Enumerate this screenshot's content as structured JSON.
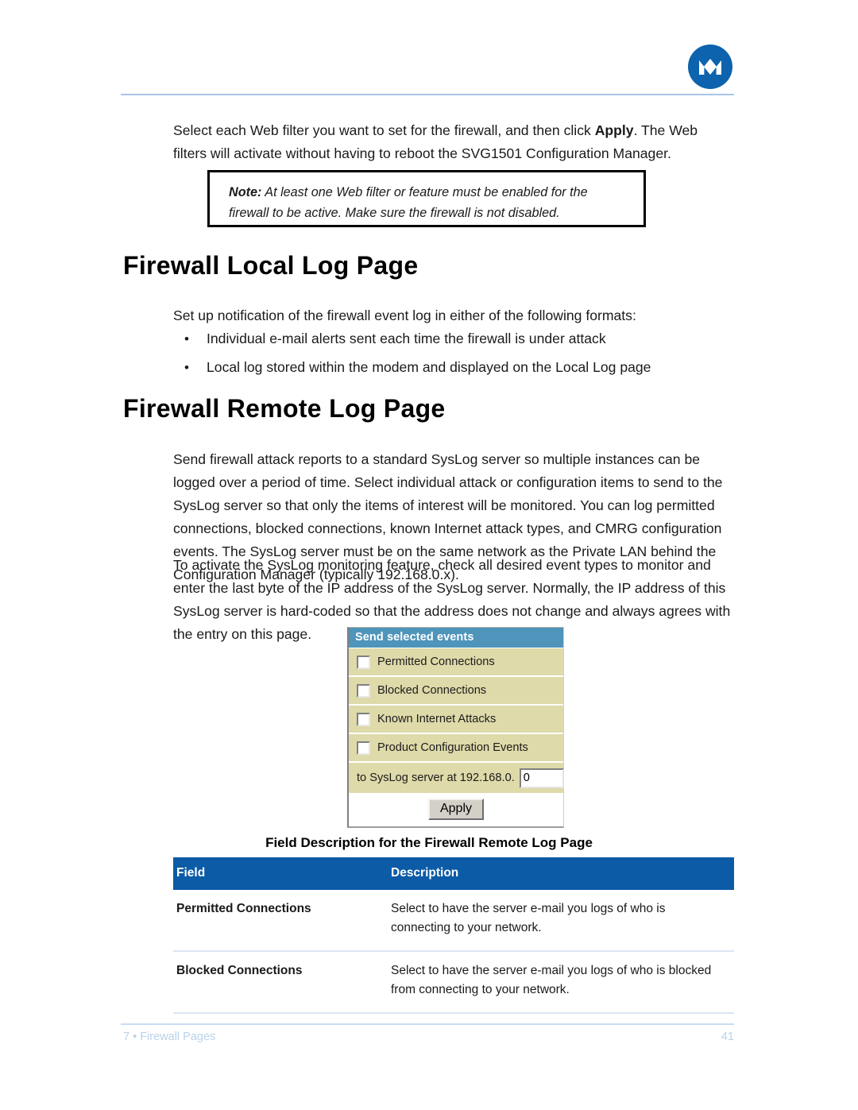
{
  "header": {
    "logo_name": "motorola-logo",
    "logo_color": "#0d63ad"
  },
  "intro": {
    "text_before_bold": "Select  each Web filter you want to set for the firewall, and then click ",
    "bold_word": "Apply",
    "text_after_bold": ". The Web filters will activate without having to reboot the SVG1501 Configuration Manager."
  },
  "note": {
    "label": "Note:",
    "text": " At least one Web filter or feature must be enabled for the firewall to be active. Make sure the firewall is not disabled."
  },
  "sections": {
    "local_heading": "Firewall Local Log Page",
    "local_intro": "Set up notification of the firewall event log in either of the following formats:",
    "local_bullets": [
      "Individual e-mail alerts sent each time the firewall is under attack",
      "Local log stored within the modem and displayed on the Local Log page"
    ],
    "remote_heading": "Firewall Remote Log Page",
    "remote_para_1": "Send firewall attack reports to a standard SysLog server so multiple instances can be logged over a period of time. Select individual attack or configuration items to send to the SysLog server so that only the items of interest will be monitored. You can log permitted connections, blocked connections, known Internet attack types, and CMRG configuration events. The SysLog server must be on the same network as the Private LAN behind the Configuration Manager (typically 192.168.0.x).",
    "remote_para_2": "To activate the SysLog monitoring feature, check all desired event types to monitor and enter the last byte of the IP address of the SysLog server. Normally, the IP address of this SysLog server is hard-coded so that the address does not change and always agrees with the entry on this page."
  },
  "widget": {
    "title": "Send selected events",
    "title_bg": "#4e94bb",
    "row_bg": "#dedaa9",
    "checkboxes": [
      {
        "label": "Permitted Connections",
        "checked": false
      },
      {
        "label": "Blocked Connections",
        "checked": false
      },
      {
        "label": "Known Internet Attacks",
        "checked": false
      },
      {
        "label": "Product Configuration Events",
        "checked": false
      }
    ],
    "ip_label": "to SysLog server at 192.168.0.",
    "ip_value": "0",
    "apply_label": "Apply"
  },
  "table": {
    "caption": "Field Description for the Firewall Remote Log Page",
    "header_bg": "#0c5ba6",
    "columns": [
      "Field",
      "Description"
    ],
    "rows": [
      {
        "field": "Permitted Connections",
        "description": "Select to have the server e-mail you logs of who is connecting to your network."
      },
      {
        "field": "Blocked Connections",
        "description": "Select to have the server e-mail you logs of who is blocked from connecting to your network."
      }
    ]
  },
  "footer": {
    "left": "7 • Firewall Pages",
    "page_number": "41"
  }
}
